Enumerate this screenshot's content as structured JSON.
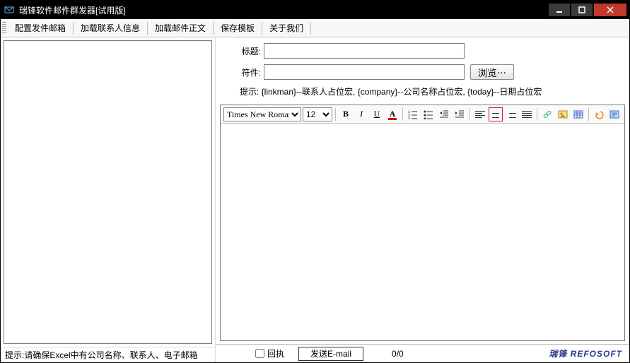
{
  "titlebar": {
    "title": "瑞锋软件邮件群发器[试用版]"
  },
  "menu": {
    "items": [
      "配置发件邮箱",
      "加载联系人信息",
      "加载邮件正文",
      "保存模板",
      "关于我们"
    ]
  },
  "left": {
    "hint": "提示:请确保Excel中有公司名称、联系人、电子邮箱"
  },
  "fields": {
    "subject_label": "标题:",
    "subject_value": "",
    "attach_label": "符件:",
    "attach_value": "",
    "browse_label": "浏览⋯"
  },
  "hint": "提示: {linkman}--联系人占位宏, {company}--公司名称占位宏, {today}--日期占位宏",
  "toolbar": {
    "font": "Times New Roman",
    "size": "12",
    "bold": "B",
    "italic": "I",
    "underline": "U",
    "fontcolor": "A"
  },
  "footer": {
    "receipt_label": "回执",
    "send_label": "发送E-mail",
    "counter": "0/0",
    "brand": "瑞锋 REFOSOFT"
  }
}
